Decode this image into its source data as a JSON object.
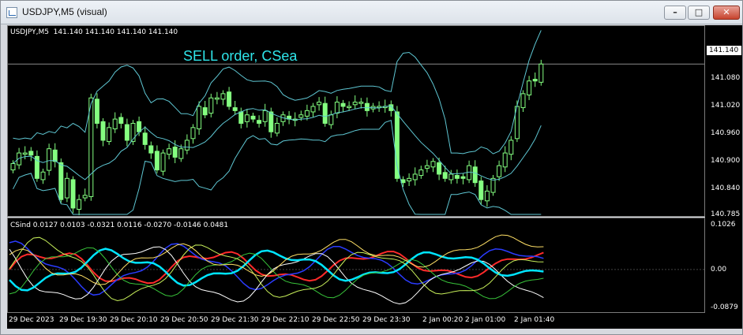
{
  "window": {
    "title": "USDJPY,M5 (visual)"
  },
  "controls": {
    "minimize": "–",
    "maximize": "□",
    "close": "✕"
  },
  "main_chart": {
    "header": "USDJPY,M5  141.140 141.140 141.140 141.140",
    "overlay_text": "SELL order, CSea",
    "price_labels": [
      "141.140",
      "141.080",
      "141.020",
      "140.960",
      "140.900",
      "140.840",
      "140.785"
    ],
    "current_price": "141.140"
  },
  "indicator": {
    "header": "CSind 0.0127 0.0103 -0.0321 0.0116 -0.0270 -0.0146 0.0481",
    "scale_labels": [
      "0.1026",
      "0.00",
      "-0.0879"
    ]
  },
  "time_axis": [
    "29 Dec 2023",
    "29 Dec 19:30",
    "29 Dec 20:10",
    "29 Dec 20:50",
    "29 Dec 21:30",
    "29 Dec 22:10",
    "29 Dec 22:50",
    "29 Dec 23:30",
    "2 Jan 00:20",
    "2 Jan 01:00",
    "2 Jan 01:40"
  ],
  "colors": {
    "bull_candle": "#84ff80",
    "bollinger": "#5ec6d2",
    "overlay": "#2fe5ea",
    "background": "#000000"
  },
  "chart_data": [
    {
      "type": "candlestick",
      "title": "USDJPY,M5",
      "ylim": [
        140.785,
        141.2
      ],
      "close": [
        140.905,
        140.93,
        140.93,
        140.925,
        140.87,
        140.885,
        140.94,
        140.91,
        140.82,
        140.87,
        140.8,
        140.82,
        140.83,
        141.06,
        141.0,
        140.96,
        140.99,
        141.01,
        141.0,
        140.96,
        141.0,
        140.98,
        140.95,
        140.93,
        140.89,
        140.93,
        140.94,
        140.92,
        140.94,
        140.96,
        140.99,
        141.04,
        141.02,
        141.06,
        141.06,
        141.07,
        141.04,
        141.03,
        141.0,
        141.02,
        141.01,
        141.0,
        141.03,
        140.98,
        141.0,
        141.02,
        141.01,
        141.01,
        141.02,
        141.03,
        141.04,
        141.05,
        141.0,
        141.02,
        141.05,
        141.04,
        141.04,
        141.05,
        141.05,
        141.03,
        141.04,
        141.04,
        141.04,
        141.03,
        140.87,
        140.86,
        140.87,
        140.88,
        140.89,
        140.9,
        140.91,
        140.88,
        140.87,
        140.88,
        140.87,
        140.87,
        140.9,
        140.86,
        140.82,
        140.84,
        140.87,
        140.9,
        140.93,
        140.96,
        141.04,
        141.07,
        141.1,
        141.1,
        141.14
      ],
      "bollinger_upper_start": 141.14,
      "last": 141.14
    },
    {
      "type": "line",
      "title": "CSind",
      "ylim": [
        -0.0879,
        0.1026
      ],
      "series": [
        {
          "values": [
            0.0127
          ]
        },
        {
          "values": [
            0.0103
          ]
        },
        {
          "values": [
            -0.0321
          ]
        },
        {
          "values": [
            0.0116
          ]
        },
        {
          "values": [
            -0.027
          ]
        },
        {
          "values": [
            -0.0146
          ]
        },
        {
          "values": [
            0.0481
          ]
        }
      ]
    }
  ]
}
